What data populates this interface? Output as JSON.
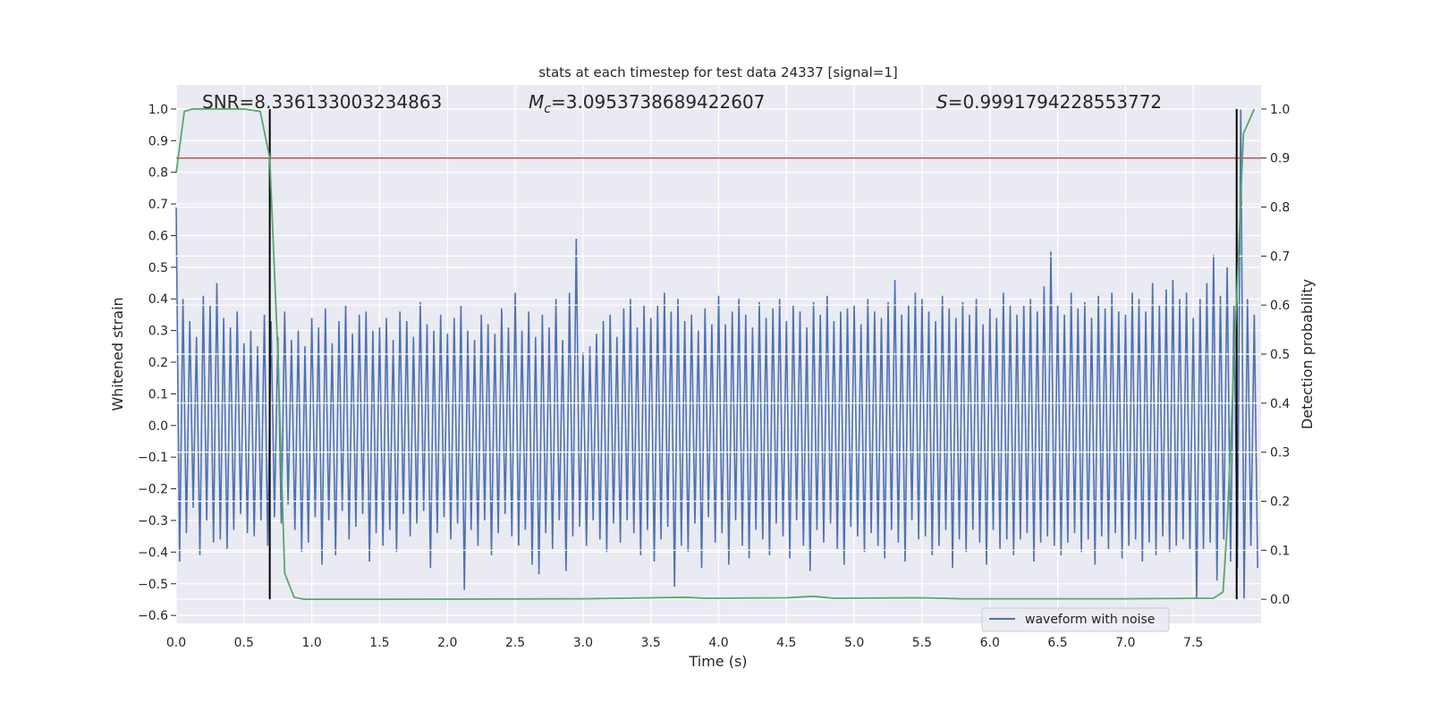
{
  "chart_data": {
    "type": "line",
    "title": "stats at each timestep for test data 24337 [signal=1]",
    "xlabel": "Time (s)",
    "ylabel": "Whitened strain",
    "y2label": "Detection probability",
    "xlim": [
      0,
      8.0
    ],
    "ylim": [
      -0.625,
      1.076
    ],
    "y2lim": [
      -0.049,
      1.049
    ],
    "xticks": [
      "0.0",
      "0.5",
      "1.0",
      "1.5",
      "2.0",
      "2.5",
      "3.0",
      "3.5",
      "4.0",
      "4.5",
      "5.0",
      "5.5",
      "6.0",
      "6.5",
      "7.0",
      "7.5"
    ],
    "yticks": [
      "1.0",
      "0.9",
      "0.8",
      "0.7",
      "0.6",
      "0.5",
      "0.4",
      "0.3",
      "0.2",
      "0.1",
      "0.0",
      "−0.1",
      "−0.2",
      "−0.3",
      "−0.4",
      "−0.5",
      "−0.6"
    ],
    "y2ticks": [
      "1.0",
      "0.9",
      "0.8",
      "0.7",
      "0.6",
      "0.5",
      "0.4",
      "0.3",
      "0.2",
      "0.1",
      "0.0"
    ],
    "grid": true,
    "legend_position": "lower-right",
    "annotations": {
      "snr": "SNR=8.336133003234863",
      "mc_symbol": "M",
      "mc_sub": "c",
      "mc_value": "=3.0953738689422607",
      "s_symbol": "S",
      "s_value": "=0.9991794228553772"
    },
    "waveform": {
      "name": "waveform with noise",
      "color": "#4c72b0",
      "x_start": 0,
      "x_step": 0.025,
      "values": [
        0.69,
        -0.43,
        0.4,
        -0.34,
        0.33,
        -0.26,
        0.28,
        -0.41,
        0.41,
        -0.3,
        0.38,
        -0.37,
        0.45,
        -0.36,
        0.34,
        -0.39,
        0.31,
        -0.33,
        0.36,
        -0.28,
        0.26,
        -0.34,
        0.3,
        -0.35,
        0.25,
        -0.3,
        0.35,
        -0.38,
        0.33,
        -0.29,
        0.28,
        -0.31,
        0.36,
        -0.25,
        0.27,
        -0.33,
        0.3,
        -0.4,
        0.25,
        -0.37,
        0.34,
        -0.29,
        0.31,
        -0.44,
        0.37,
        -0.3,
        0.26,
        -0.41,
        0.33,
        -0.27,
        0.38,
        -0.36,
        0.29,
        -0.32,
        0.35,
        -0.28,
        0.36,
        -0.43,
        0.3,
        -0.34,
        0.31,
        -0.38,
        0.34,
        -0.33,
        0.27,
        -0.4,
        0.36,
        -0.28,
        0.33,
        -0.35,
        0.28,
        -0.31,
        0.39,
        -0.27,
        0.32,
        -0.45,
        0.3,
        -0.34,
        0.35,
        -0.29,
        0.29,
        -0.36,
        0.34,
        -0.31,
        0.38,
        -0.52,
        0.3,
        -0.33,
        0.27,
        -0.38,
        0.35,
        -0.3,
        0.32,
        -0.41,
        0.29,
        -0.34,
        0.37,
        -0.28,
        0.31,
        -0.35,
        0.42,
        -0.38,
        0.3,
        -0.33,
        0.36,
        -0.44,
        0.28,
        -0.47,
        0.35,
        -0.34,
        0.31,
        -0.39,
        0.4,
        -0.3,
        0.27,
        -0.46,
        0.42,
        -0.35,
        0.59,
        -0.32,
        0.23,
        -0.38,
        0.25,
        -0.3,
        0.29,
        -0.36,
        0.33,
        -0.4,
        0.35,
        -0.31,
        0.28,
        -0.37,
        0.37,
        -0.3,
        0.4,
        -0.34,
        0.31,
        -0.41,
        0.38,
        -0.33,
        0.34,
        -0.43,
        0.38,
        -0.36,
        0.42,
        -0.32,
        0.36,
        -0.51,
        0.4,
        -0.38,
        0.33,
        -0.4,
        0.35,
        -0.31,
        0.3,
        -0.45,
        0.37,
        -0.29,
        0.32,
        -0.37,
        0.41,
        -0.34,
        0.32,
        -0.44,
        0.36,
        -0.3,
        0.4,
        -0.38,
        0.35,
        -0.42,
        0.31,
        -0.33,
        0.39,
        -0.36,
        0.34,
        -0.41,
        0.37,
        -0.31,
        0.4,
        -0.35,
        0.33,
        -0.42,
        0.38,
        -0.3,
        0.36,
        -0.38,
        0.31,
        -0.46,
        0.39,
        -0.33,
        0.35,
        -0.37,
        0.41,
        -0.31,
        0.33,
        -0.39,
        0.36,
        -0.44,
        0.37,
        -0.32,
        0.38,
        -0.35,
        0.32,
        -0.4,
        0.4,
        -0.34,
        0.36,
        -0.38,
        0.34,
        -0.42,
        0.39,
        -0.33,
        0.46,
        -0.37,
        0.35,
        -0.43,
        0.38,
        -0.3,
        0.42,
        -0.36,
        0.4,
        -0.35,
        0.36,
        -0.41,
        0.33,
        -0.38,
        0.41,
        -0.33,
        0.37,
        -0.45,
        0.34,
        -0.36,
        0.39,
        -0.4,
        0.35,
        -0.33,
        0.4,
        -0.37,
        0.32,
        -0.44,
        0.37,
        -0.33,
        0.34,
        -0.39,
        0.42,
        -0.36,
        0.38,
        -0.41,
        0.35,
        -0.36,
        0.38,
        -0.34,
        0.4,
        -0.43,
        0.36,
        -0.37,
        0.44,
        -0.35,
        0.55,
        -0.38,
        0.38,
        -0.41,
        0.35,
        -0.37,
        0.42,
        -0.34,
        0.37,
        -0.4,
        0.39,
        -0.36,
        0.34,
        -0.44,
        0.41,
        -0.35,
        0.37,
        -0.39,
        0.42,
        -0.34,
        0.36,
        -0.42,
        0.35,
        -0.38,
        0.42,
        -0.36,
        0.4,
        -0.43,
        0.36,
        -0.37,
        0.45,
        -0.41,
        0.38,
        -0.35,
        0.43,
        -0.4,
        0.46,
        -0.38,
        0.4,
        -0.36,
        0.42,
        -0.39,
        0.34,
        -0.55,
        0.4,
        -0.39,
        0.45,
        -0.37,
        0.54,
        -0.49,
        0.41,
        -0.36,
        0.5,
        -0.43,
        0.38,
        -0.45,
        1.0,
        -0.55,
        0.4,
        -0.38,
        0.35,
        -0.45
      ]
    },
    "detection_probability": {
      "color": "#55a868",
      "points": [
        [
          0,
          0.87
        ],
        [
          0.06,
          0.995
        ],
        [
          0.12,
          1.0
        ],
        [
          0.25,
          1.0
        ],
        [
          0.37,
          1.0
        ],
        [
          0.5,
          1.0
        ],
        [
          0.62,
          0.995
        ],
        [
          0.69,
          0.9
        ],
        [
          0.75,
          0.5
        ],
        [
          0.8,
          0.053
        ],
        [
          0.87,
          0.004
        ],
        [
          0.94,
          0.0
        ],
        [
          1.5,
          0.0
        ],
        [
          3.0,
          0.001
        ],
        [
          3.5,
          0.003
        ],
        [
          3.75,
          0.004
        ],
        [
          3.9,
          0.002
        ],
        [
          4.5,
          0.003
        ],
        [
          4.7,
          0.006
        ],
        [
          4.85,
          0.002
        ],
        [
          5.5,
          0.003
        ],
        [
          5.8,
          0.001
        ],
        [
          7.0,
          0.001
        ],
        [
          7.65,
          0.002
        ],
        [
          7.72,
          0.015
        ],
        [
          7.75,
          0.15
        ],
        [
          7.87,
          0.95
        ],
        [
          7.95,
          1.0
        ]
      ]
    },
    "threshold": {
      "value": 0.9,
      "color": "#c44e52"
    },
    "markers": {
      "times": [
        0.69,
        7.82
      ],
      "range": [
        0,
        1.0
      ],
      "color": "#000000"
    }
  }
}
